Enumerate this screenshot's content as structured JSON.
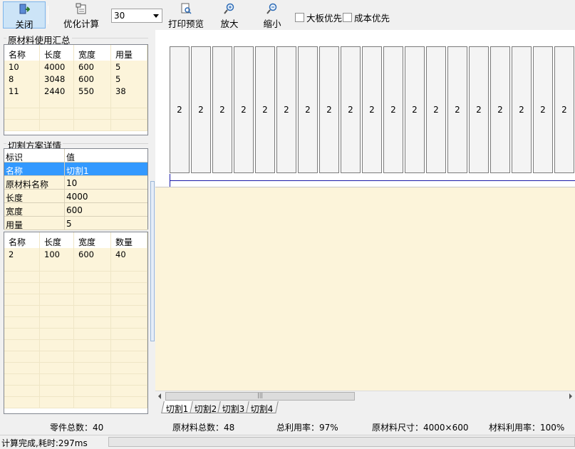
{
  "toolbar": {
    "close_label": "关闭",
    "optimize_label": "优化计算",
    "kerf_value": "30",
    "preview_label": "打印预览",
    "zoom_in_label": "放大",
    "zoom_out_label": "缩小",
    "big_board_first_label": "大板优先",
    "cost_first_label": "成本优先"
  },
  "material_summary": {
    "title": "原材料使用汇总",
    "columns": [
      "名称",
      "长度",
      "宽度",
      "用量"
    ],
    "rows": [
      [
        "10",
        "4000",
        "600",
        "5"
      ],
      [
        "8",
        "3048",
        "600",
        "5"
      ],
      [
        "11",
        "2440",
        "550",
        "38"
      ]
    ]
  },
  "plan_detail": {
    "title": "切割方案详情",
    "header": [
      "标识",
      "值"
    ],
    "props": [
      [
        "名称",
        "切割1"
      ],
      [
        "原材料名称",
        "10"
      ],
      [
        "长度",
        "4000"
      ],
      [
        "宽度",
        "600"
      ],
      [
        "用量",
        "5"
      ]
    ]
  },
  "parts": {
    "columns": [
      "名称",
      "长度",
      "宽度",
      "数量"
    ],
    "rows": [
      [
        "2",
        "100",
        "600",
        "40"
      ]
    ]
  },
  "canvas": {
    "piece_label": "2",
    "piece_count_visible": 19
  },
  "tabs": [
    "切割1",
    "切割2",
    "切割3",
    "切割4"
  ],
  "summary": {
    "parts_total": "零件总数：40",
    "material_total": "原材料总数：48",
    "total_utilization": "总利用率：97%",
    "material_size": "原材料尺寸：4000×600",
    "material_utilization": "材料利用率：100%"
  },
  "status": {
    "message": "计算完成,耗时:297ms"
  }
}
